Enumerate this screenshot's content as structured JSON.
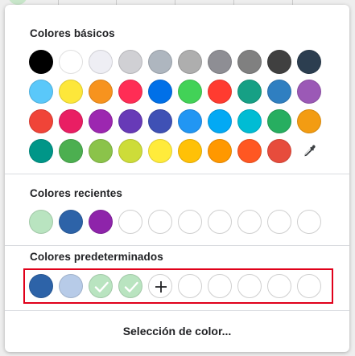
{
  "sections": {
    "basic_title": "Colores básicos",
    "recent_title": "Colores recientes",
    "default_title": "Colores predeterminados"
  },
  "basic_colors": [
    [
      "#000000",
      "#ffffff",
      "#eeeef4",
      "#d0d0d4",
      "#aeb6bf",
      "#aeaeae",
      "#8e8e94",
      "#808080",
      "#404040",
      "#2c3e50"
    ],
    [
      "#5ac8fa",
      "#fde73a",
      "#f7931e",
      "#ff2d55",
      "#0070e8",
      "#42d257",
      "#ff3b30",
      "#16a085",
      "#2f7fc1",
      "#9b59b6"
    ],
    [
      "#f04438",
      "#e91e63",
      "#9c27b0",
      "#673ab7",
      "#3f51b5",
      "#2196f3",
      "#03a9f4",
      "#00bcd4",
      "#27ae60",
      "#f39c12"
    ],
    [
      "#009688",
      "#4caf50",
      "#8bc34a",
      "#cddc39",
      "#ffeb3b",
      "#ffc107",
      "#ff9800",
      "#ff5722",
      "#e74c3c"
    ]
  ],
  "recent_colors": [
    "#b9e4c0",
    "#2d63a8",
    "#8e24aa",
    "",
    "",
    "",
    "",
    "",
    "",
    ""
  ],
  "default_colors": [
    {
      "color": "#2d63a8",
      "state": "filled"
    },
    {
      "color": "#b7cbe8",
      "state": "filled"
    },
    {
      "color": "#b9e4c0",
      "state": "checked"
    },
    {
      "color": "#b9e4c0",
      "state": "checked"
    },
    {
      "color": "",
      "state": "add"
    },
    {
      "color": "",
      "state": "empty"
    },
    {
      "color": "",
      "state": "empty"
    },
    {
      "color": "",
      "state": "empty"
    },
    {
      "color": "",
      "state": "empty"
    },
    {
      "color": "",
      "state": "empty"
    }
  ],
  "icons": {
    "eyedropper": "eyedropper-icon",
    "check": "check-icon",
    "add": "plus-icon"
  },
  "footer": {
    "label": "Selección de color..."
  },
  "colors": {
    "highlight": "#e0001a"
  }
}
